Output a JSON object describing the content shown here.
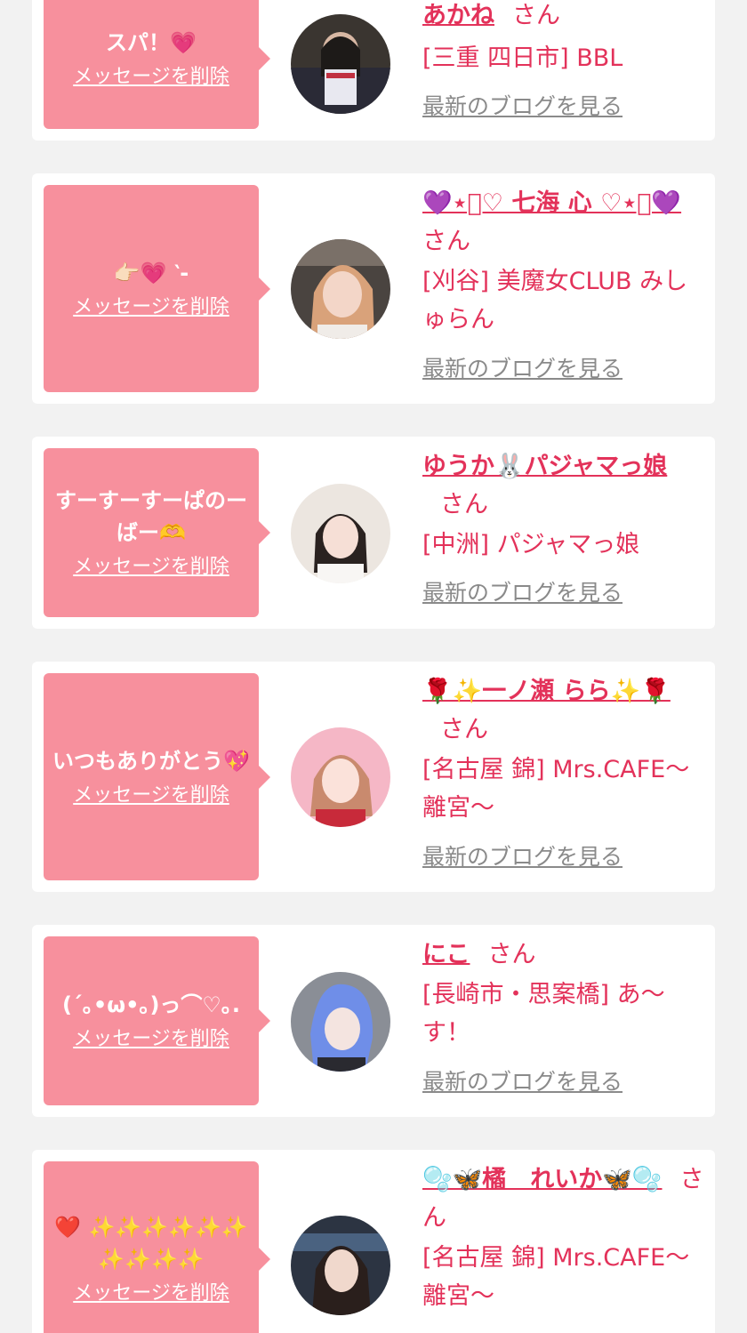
{
  "delete_label": "メッセージを削除",
  "san_label": "さん",
  "blog_label": "最新のブログを見る",
  "colors": {
    "accent": "#e3325a",
    "bubble": "#f7909d",
    "link_gray": "#8a8a8a",
    "bg": "#f2f2f2"
  },
  "cards": [
    {
      "message": "スパ！💗",
      "name": "あかね",
      "shop": "[三重 四日市] BBL"
    },
    {
      "message": "👉🏻💗 ‵-",
      "name": "💜⋆͛♡ 七海 心 ♡⋆͛💜",
      "shop": "[刈谷] 美魔女CLUB みしゅらん"
    },
    {
      "message": "すーすーすーぱのーばー🫶",
      "name": "ゆうか🐰パジャマっ娘",
      "shop": "[中洲] パジャマっ娘"
    },
    {
      "message": "いつもありがとう💖",
      "name": "🌹✨一ノ瀬 らら✨🌹",
      "shop": "[名古屋 錦] Mrs.CAFE〜離宮〜"
    },
    {
      "message": "(´｡•ω•｡)っ⌒♡｡.",
      "name": "にこ",
      "shop": "[長崎市・思案橋] あ〜す！"
    },
    {
      "message": "❤️ ✨✨✨✨✨✨ ✨✨✨✨",
      "name": "🫧🦋橘　れいか🦋🫧",
      "shop": "[名古屋 錦] Mrs.CAFE〜離宮〜"
    }
  ]
}
